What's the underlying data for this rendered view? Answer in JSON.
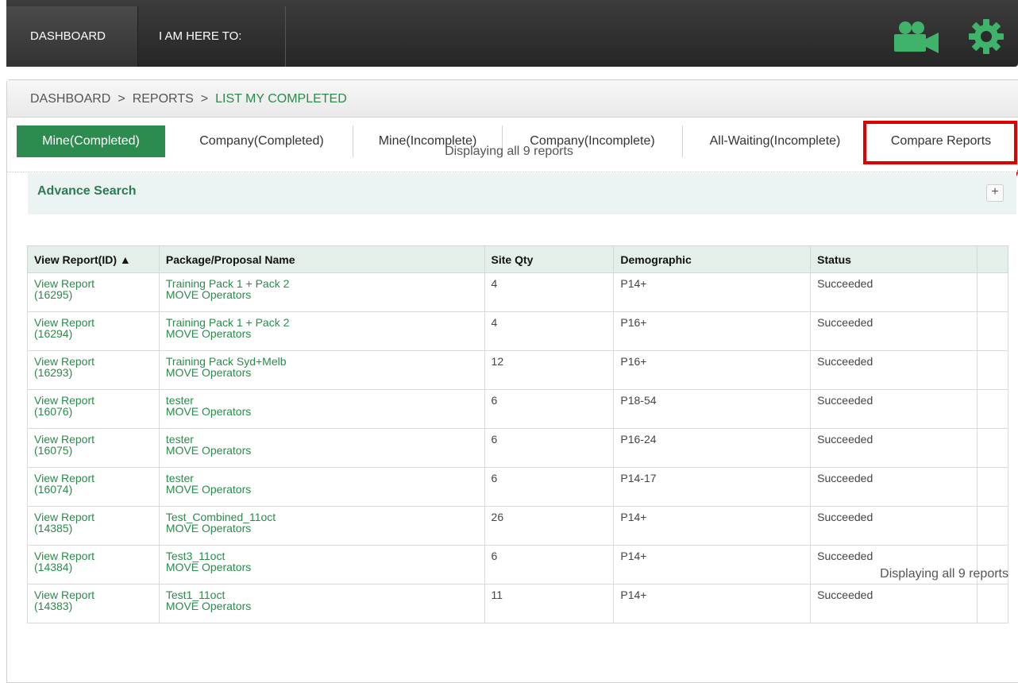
{
  "topbar": {
    "dashboard_label": "DASHBOARD",
    "here_label": "I AM HERE TO:",
    "icons": [
      "video-camera-icon",
      "gear-icon"
    ],
    "accent": "#3fb36a"
  },
  "breadcrumb": {
    "items": [
      "DASHBOARD",
      "REPORTS",
      "LIST MY COMPLETED"
    ],
    "separator": ">"
  },
  "tabs": [
    {
      "label": "Mine(Completed)",
      "active": true
    },
    {
      "label": "Company(Completed)"
    },
    {
      "label": "Mine(Incomplete)"
    },
    {
      "label": "Company(Incomplete)"
    },
    {
      "label": "All-Waiting(Incomplete)"
    },
    {
      "label": "Compare Reports",
      "highlighted": true
    }
  ],
  "advance_search": {
    "title": "Advance Search",
    "toggle": "+"
  },
  "display_count": "Displaying all 9 reports",
  "table": {
    "headers": [
      "View Report(ID) ▲",
      "Package/Proposal Name",
      "Site Qty",
      "Demographic",
      "Status",
      ""
    ],
    "rows": [
      {
        "view": "View Report",
        "id": "(16295)",
        "name": "Training Pack 1 + Pack 2",
        "operator": "MOVE Operators",
        "qty": "4",
        "demo": "P14+",
        "status": "Succeeded"
      },
      {
        "view": "View Report",
        "id": "(16294)",
        "name": "Training Pack 1 + Pack 2",
        "operator": "MOVE Operators",
        "qty": "4",
        "demo": "P16+",
        "status": "Succeeded"
      },
      {
        "view": "View Report",
        "id": "(16293)",
        "name": "Training Pack Syd+Melb",
        "operator": "MOVE Operators",
        "qty": "12",
        "demo": "P16+",
        "status": "Succeeded"
      },
      {
        "view": "View Report",
        "id": "(16076)",
        "name": "tester",
        "operator": "MOVE Operators",
        "qty": "6",
        "demo": "P18-54",
        "status": "Succeeded"
      },
      {
        "view": "View Report",
        "id": "(16075)",
        "name": "tester",
        "operator": "MOVE Operators",
        "qty": "6",
        "demo": "P16-24",
        "status": "Succeeded"
      },
      {
        "view": "View Report",
        "id": "(16074)",
        "name": "tester",
        "operator": "MOVE Operators",
        "qty": "6",
        "demo": "P14-17",
        "status": "Succeeded"
      },
      {
        "view": "View Report",
        "id": "(14385)",
        "name": "Test_Combined_11oct",
        "operator": "MOVE Operators",
        "qty": "26",
        "demo": "P14+",
        "status": "Succeeded"
      },
      {
        "view": "View Report",
        "id": "(14384)",
        "name": "Test3_11oct",
        "operator": "MOVE Operators",
        "qty": "6",
        "demo": "P14+",
        "status": "Succeeded"
      },
      {
        "view": "View Report",
        "id": "(14383)",
        "name": "Test1_11oct",
        "operator": "MOVE Operators",
        "qty": "11",
        "demo": "P14+",
        "status": "Succeeded"
      }
    ]
  }
}
